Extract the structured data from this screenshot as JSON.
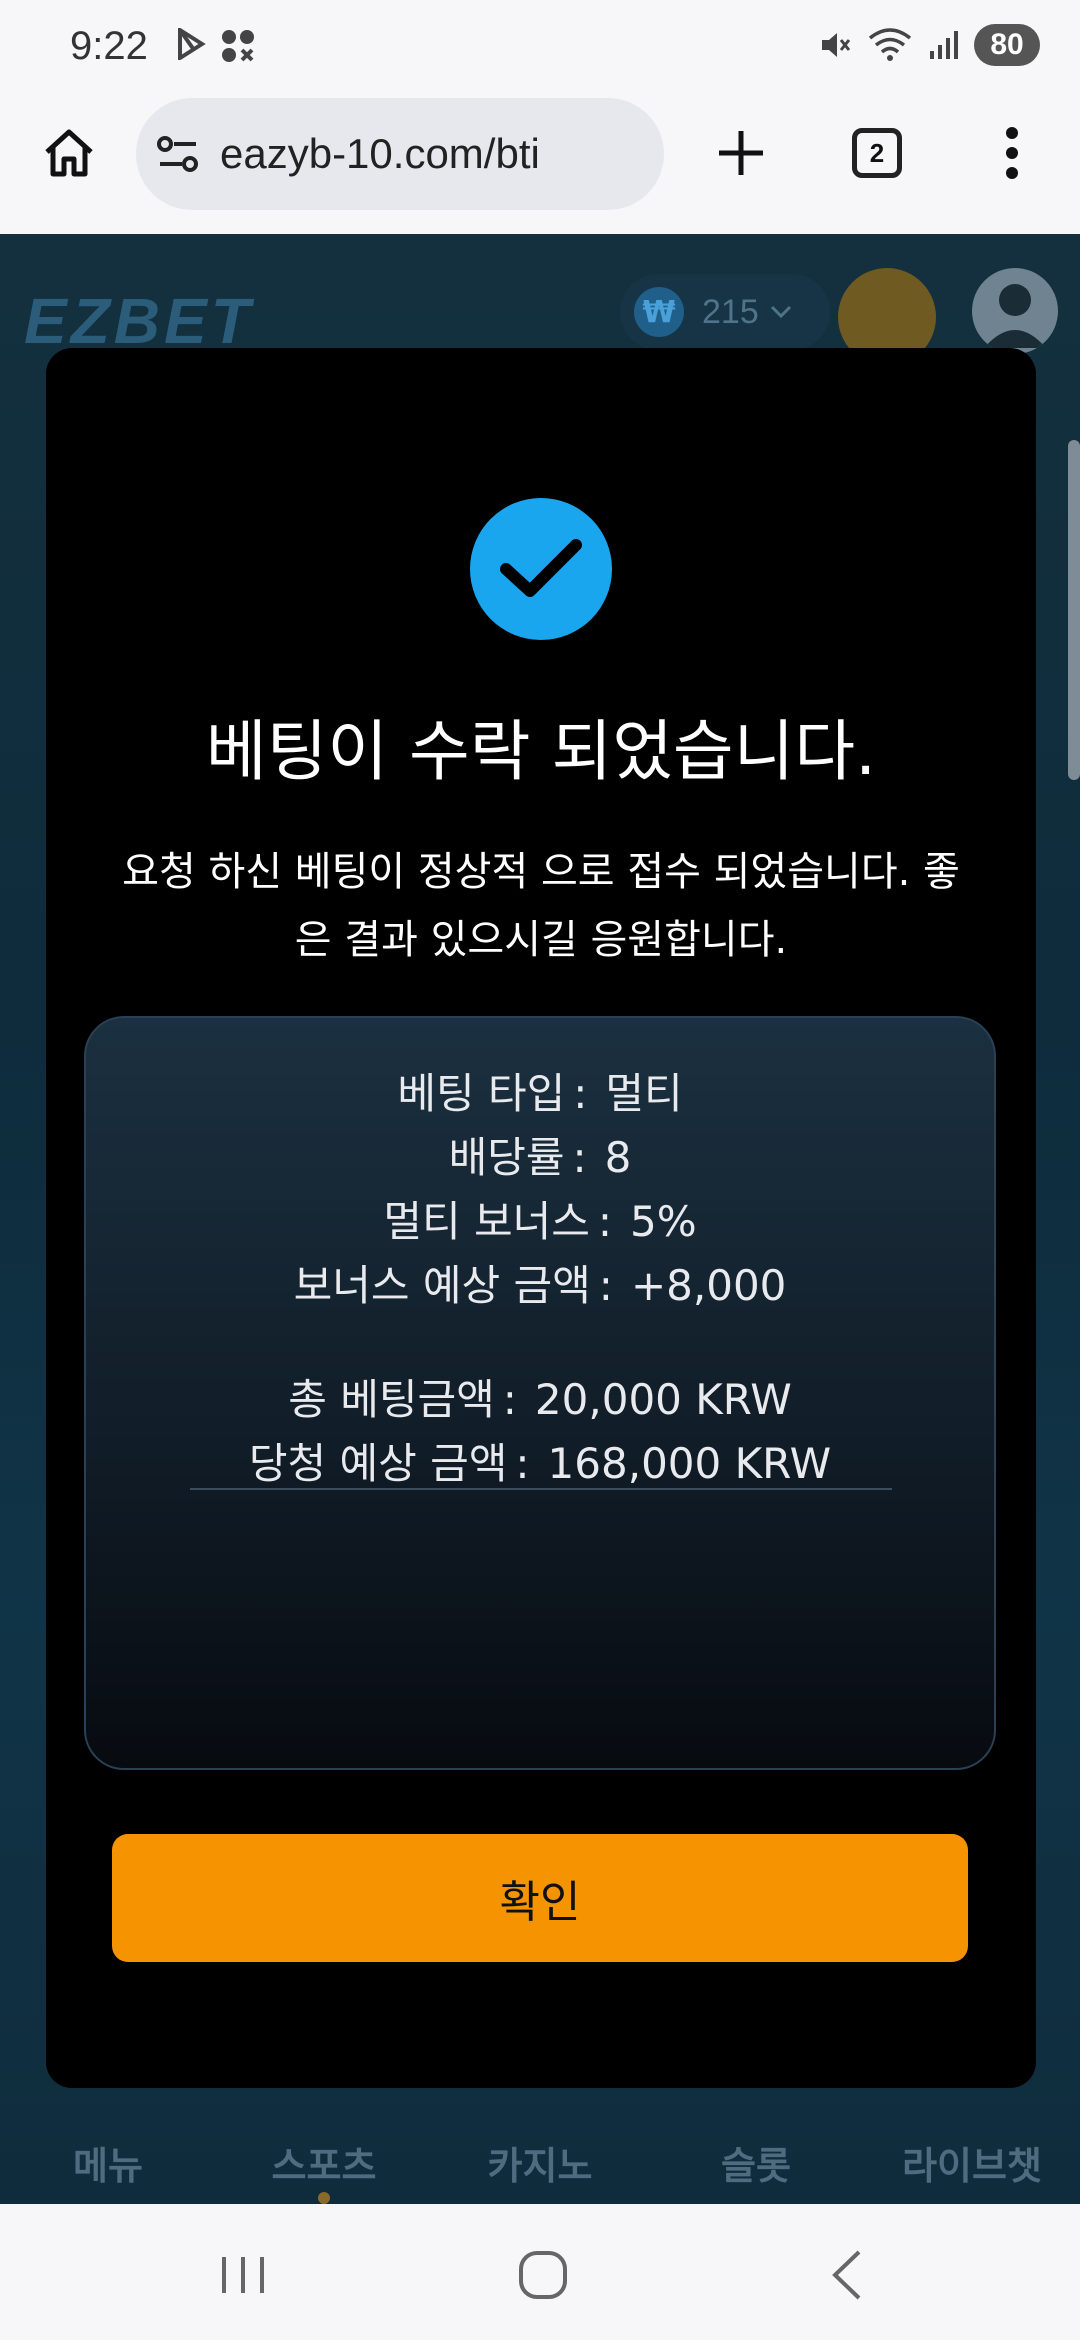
{
  "status_bar": {
    "time": "9:22",
    "battery": "80",
    "icons": [
      "play-store-icon",
      "app-grid-icon",
      "mute-icon",
      "wifi-icon",
      "signal-icon"
    ]
  },
  "browser": {
    "url": "eazyb-10.com/bti",
    "tab_count": "2"
  },
  "site": {
    "logo": "EZBET",
    "balance": "215",
    "currency_symbol": "₩",
    "nav": [
      {
        "label": "메뉴"
      },
      {
        "label": "스포츠"
      },
      {
        "label": "카지노"
      },
      {
        "label": "슬롯"
      },
      {
        "label": "라이브챗"
      }
    ]
  },
  "modal": {
    "title": "베팅이 수락 되었습니다.",
    "message": "요청 하신 베팅이 정상적 으로 접수 되었습니다. 좋은 결과 있으시길 응원합니다.",
    "rows": [
      {
        "label": "베팅 타입",
        "value": "멀티"
      },
      {
        "label": "배당률",
        "value": "8"
      },
      {
        "label": "멀티 보너스",
        "value": "5%"
      },
      {
        "label": "보너스 예상 금액",
        "value": "+8,000"
      },
      {
        "label": "총 베팅금액",
        "value": "20,000 KRW"
      },
      {
        "label": "당청 예상 금액",
        "value": "168,000 KRW"
      }
    ],
    "confirm_label": "확인"
  },
  "colors": {
    "accent_button": "#f59300",
    "check_circle": "#19a6ee"
  }
}
